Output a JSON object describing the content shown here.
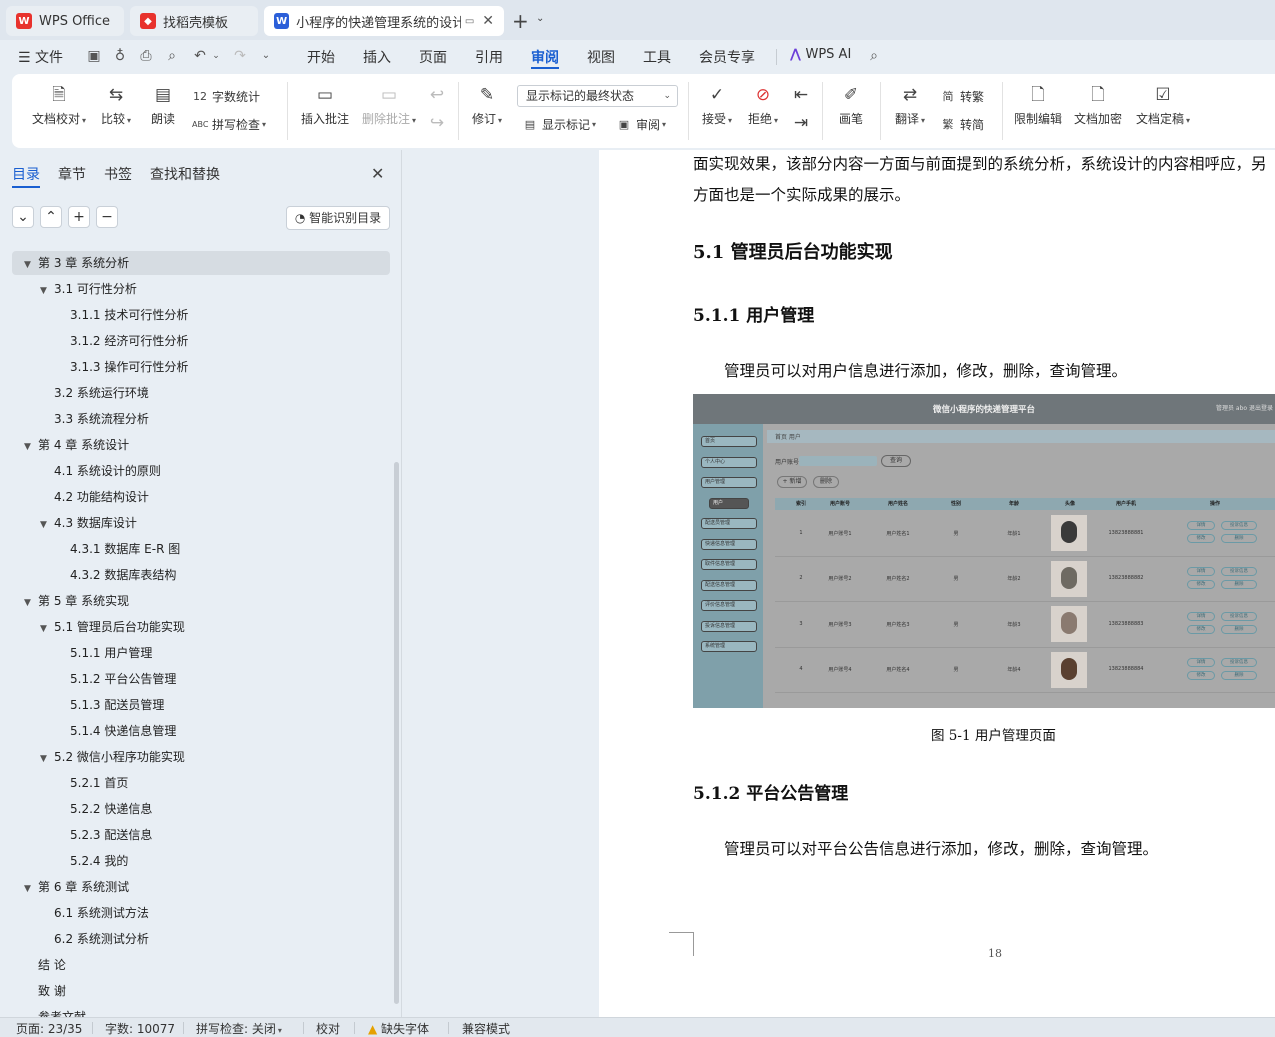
{
  "titlebar": {
    "tabs": [
      {
        "label": "WPS Office",
        "icon": "wps-logo-icon"
      },
      {
        "label": "找稻壳模板",
        "icon": "docer-icon"
      },
      {
        "label": "小程序的快递管理系统的设计-",
        "icon": "word-doc-icon"
      }
    ],
    "new_tab": "+",
    "colors": {
      "wps_red": "#e8322d",
      "word_blue": "#2b5fd9"
    }
  },
  "menubar": {
    "file": "文件",
    "tabs": [
      "开始",
      "插入",
      "页面",
      "引用",
      "审阅",
      "视图",
      "工具",
      "会员专享"
    ],
    "active_tab": "审阅",
    "wps_ai": "WPS AI"
  },
  "ribbon": {
    "doc_check": "文档校对",
    "compare": "比较",
    "read_aloud": "朗读",
    "word_count": "字数统计",
    "spell_check": "拼写检查",
    "insert_comment": "插入批注",
    "delete_comment": "删除批注",
    "revise": "修订",
    "markup_state": "显示标记的最终状态",
    "show_markup": "显示标记",
    "review": "审阅",
    "accept": "接受",
    "reject": "拒绝",
    "pen": "画笔",
    "translate": "翻译",
    "to_traditional": "转繁",
    "to_simplified": "转简",
    "restrict_edit": "限制编辑",
    "doc_encrypt": "文档加密",
    "doc_finalize": "文档定稿"
  },
  "panel": {
    "tabs": [
      "目录",
      "章节",
      "书签",
      "查找和替换"
    ],
    "smart_toc": "智能识别目录",
    "toc": [
      {
        "text": "第 3 章  系统分析",
        "level": 1,
        "tri": "▼",
        "selected": true
      },
      {
        "text": "3.1 可行性分析",
        "level": 2,
        "tri": "▼"
      },
      {
        "text": "3.1.1 技术可行性分析",
        "level": 3,
        "tri": ""
      },
      {
        "text": "3.1.2 经济可行性分析",
        "level": 3,
        "tri": ""
      },
      {
        "text": "3.1.3 操作可行性分析",
        "level": 3,
        "tri": ""
      },
      {
        "text": "3.2 系统运行环境",
        "level": 2,
        "tri": ""
      },
      {
        "text": "3.3 系统流程分析",
        "level": 2,
        "tri": ""
      },
      {
        "text": "第 4 章  系统设计",
        "level": 1,
        "tri": "▼"
      },
      {
        "text": "4.1  系统设计的原则",
        "level": 2,
        "tri": ""
      },
      {
        "text": "4.2  功能结构设计",
        "level": 2,
        "tri": ""
      },
      {
        "text": "4.3  数据库设计",
        "level": 2,
        "tri": "▼"
      },
      {
        "text": "4.3.1  数据库 E-R 图",
        "level": 3,
        "tri": ""
      },
      {
        "text": "4.3.2  数据库表结构",
        "level": 3,
        "tri": ""
      },
      {
        "text": "第 5 章  系统实现",
        "level": 1,
        "tri": "▼"
      },
      {
        "text": "5.1 管理员后台功能实现",
        "level": 2,
        "tri": "▼"
      },
      {
        "text": "5.1.1  用户管理",
        "level": 3,
        "tri": ""
      },
      {
        "text": "5.1.2  平台公告管理",
        "level": 3,
        "tri": ""
      },
      {
        "text": "5.1.3  配送员管理",
        "level": 3,
        "tri": ""
      },
      {
        "text": "5.1.4  快递信息管理",
        "level": 3,
        "tri": ""
      },
      {
        "text": "5.2  微信小程序功能实现",
        "level": 2,
        "tri": "▼"
      },
      {
        "text": "5.2.1  首页",
        "level": 3,
        "tri": ""
      },
      {
        "text": "5.2.2  快递信息",
        "level": 3,
        "tri": ""
      },
      {
        "text": "5.2.3  配送信息",
        "level": 3,
        "tri": ""
      },
      {
        "text": "5.2.4  我的",
        "level": 3,
        "tri": ""
      },
      {
        "text": "第 6 章  系统测试",
        "level": 1,
        "tri": "▼"
      },
      {
        "text": "6.1 系统测试方法",
        "level": 2,
        "tri": ""
      },
      {
        "text": "6.2  系统测试分析",
        "level": 2,
        "tri": ""
      },
      {
        "text": "结    论",
        "level": 1,
        "tri": ""
      },
      {
        "text": "致    谢",
        "level": 1,
        "tri": ""
      },
      {
        "text": "参考文献",
        "level": 1,
        "tri": ""
      }
    ]
  },
  "document": {
    "line1": "面实现效果，该部分内容一方面与前面提到的系统分析，系统设计的内容相呼应，另",
    "line2": "方面也是一个实际成果的展示。",
    "h_5_1": "5.1 管理员后台功能实现",
    "h_5_1_1": "5.1.1  用户管理",
    "p_user": "管理员可以对用户信息进行添加，修改，删除，查询管理。",
    "caption": "图 5-1  用户管理页面",
    "h_5_1_2": "5.1.2  平台公告管理",
    "p_notice": "管理员可以对平台公告信息进行添加，修改，删除，查询管理。",
    "page_number": "18",
    "screenshot": {
      "title": "微信小程序的快递管理平台",
      "top_right": "管理员 abo   退出登录",
      "breadcrumb": "首页  用户",
      "search_label": "用户账号",
      "search_btn": "查询",
      "add_btn": "+ 新增",
      "del_btn": "删除",
      "sidebar": [
        "首页",
        "个人中心",
        "用户管理",
        "用户",
        "配送员管理",
        "快递信息管理",
        "取件信息管理",
        "配送信息管理",
        "评价信息管理",
        "投诉信息管理",
        "系统管理"
      ],
      "columns": [
        "",
        "索引",
        "用户账号",
        "用户姓名",
        "性别",
        "年龄",
        "头像",
        "用户手机",
        "操作"
      ],
      "rows": [
        [
          "1",
          "用户账号1",
          "用户姓名1",
          "男",
          "年龄1",
          "13823888881"
        ],
        [
          "2",
          "用户账号2",
          "用户姓名2",
          "男",
          "年龄2",
          "13823888882"
        ],
        [
          "3",
          "用户账号3",
          "用户姓名3",
          "男",
          "年龄3",
          "13823888883"
        ],
        [
          "4",
          "用户账号4",
          "用户姓名4",
          "男",
          "年龄4",
          "13823888884"
        ]
      ],
      "row_actions": [
        "详情",
        "投诉信息",
        "修改",
        "删除"
      ]
    }
  },
  "status": {
    "page": "页面: 23/35",
    "words": "字数: 10077",
    "spell": "拼写检查: 关闭",
    "proof": "校对",
    "missing_font": "缺失字体",
    "compat": "兼容模式"
  }
}
